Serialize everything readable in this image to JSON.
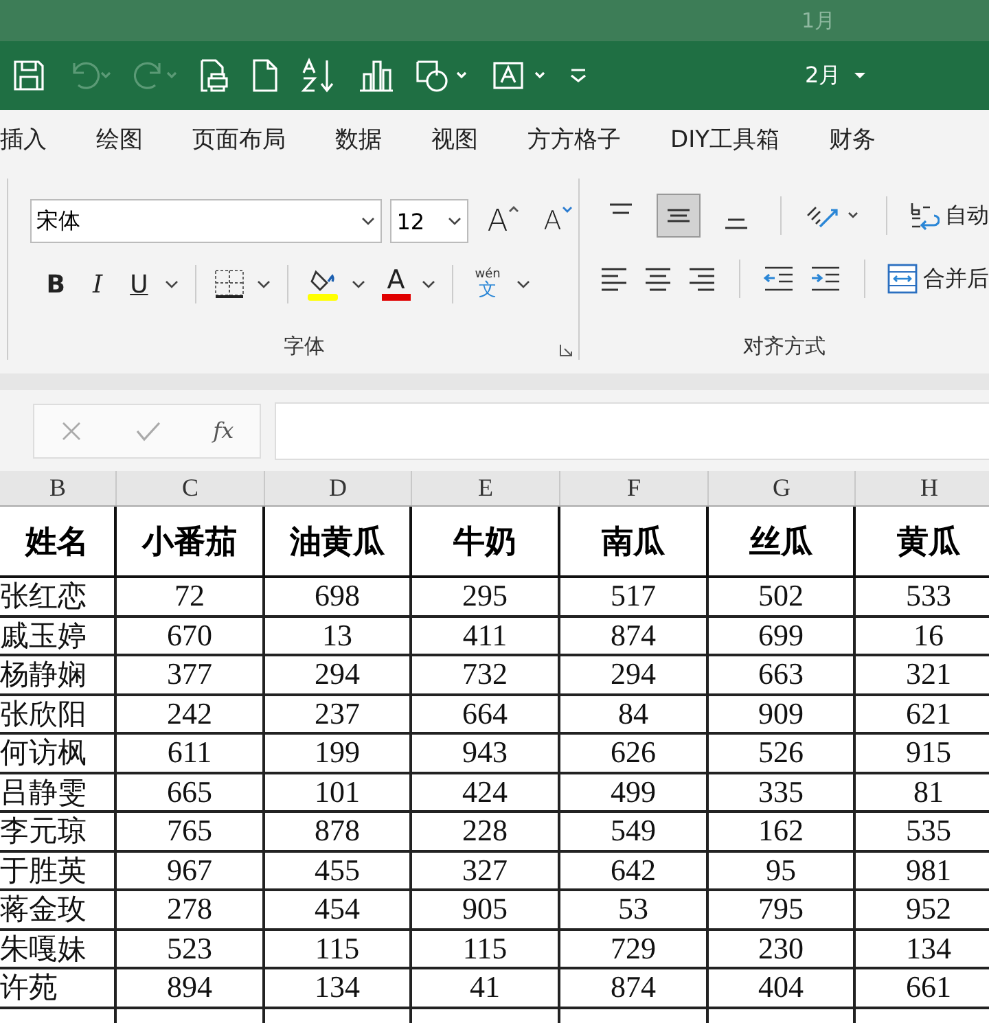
{
  "ghost_toolbar": {
    "month": "1月"
  },
  "quick_access": {
    "buttons": [
      {
        "kind": "save",
        "disabled": false
      },
      {
        "kind": "undo",
        "disabled": true
      },
      {
        "kind": "redo",
        "disabled": true
      },
      {
        "kind": "print",
        "disabled": false
      },
      {
        "kind": "new",
        "disabled": false
      },
      {
        "kind": "sort",
        "disabled": false
      },
      {
        "kind": "chart",
        "disabled": false
      },
      {
        "kind": "shapes",
        "disabled": false
      },
      {
        "kind": "textbox",
        "disabled": false
      },
      {
        "kind": "customize",
        "disabled": false
      }
    ],
    "month": "2月"
  },
  "tabs": [
    "插入",
    "绘图",
    "页面布局",
    "数据",
    "视图",
    "方方格子",
    "DIY工具箱",
    "财务"
  ],
  "font_group": {
    "font": "宋体",
    "size": "12",
    "grow": "A",
    "shrink": "A",
    "bold": "B",
    "italic": "I",
    "underline": "U",
    "font_color": "A",
    "phonetic_top": "wén",
    "phonetic_char": "文",
    "label": "字体"
  },
  "alignment_group": {
    "vertical": [
      {
        "kind": "top",
        "selected": false
      },
      {
        "kind": "middle",
        "selected": true
      },
      {
        "kind": "bottom",
        "selected": false
      }
    ],
    "wrap_text": "自动",
    "merge": "合并后",
    "label": "对齐方式"
  },
  "formula_bar": {
    "function_label": "fx"
  },
  "sheet": {
    "columns": [
      "B",
      "C",
      "D",
      "E",
      "F",
      "G",
      "H"
    ],
    "header": [
      "姓名",
      "小番茄",
      "油黄瓜",
      "牛奶",
      "南瓜",
      "丝瓜",
      "黄瓜"
    ],
    "rows": [
      [
        "张红恋",
        "72",
        "698",
        "295",
        "517",
        "502",
        "533"
      ],
      [
        "戚玉婷",
        "670",
        "13",
        "411",
        "874",
        "699",
        "16"
      ],
      [
        "杨静娴",
        "377",
        "294",
        "732",
        "294",
        "663",
        "321"
      ],
      [
        "张欣阳",
        "242",
        "237",
        "664",
        "84",
        "909",
        "621"
      ],
      [
        "何访枫",
        "611",
        "199",
        "943",
        "626",
        "526",
        "915"
      ],
      [
        "吕静雯",
        "665",
        "101",
        "424",
        "499",
        "335",
        "81"
      ],
      [
        "李元琼",
        "765",
        "878",
        "228",
        "549",
        "162",
        "535"
      ],
      [
        "于胜英",
        "967",
        "455",
        "327",
        "642",
        "95",
        "981"
      ],
      [
        "蒋金玫",
        "278",
        "454",
        "905",
        "53",
        "795",
        "952"
      ],
      [
        "朱嘎妹",
        "523",
        "115",
        "115",
        "729",
        "230",
        "134"
      ],
      [
        "许苑",
        "894",
        "134",
        "41",
        "874",
        "404",
        "661"
      ]
    ]
  }
}
